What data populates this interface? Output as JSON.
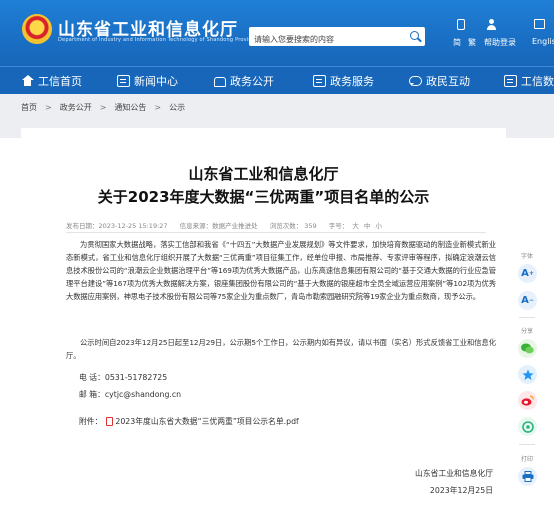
{
  "header": {
    "site_title": "山东省工业和信息化厅",
    "site_subtitle": "Department of Industry and Information Technology of Shandong Province",
    "search_placeholder": "请输入您要搜索的内容",
    "top_links": [
      "简",
      "繁",
      "帮助登录",
      "English"
    ]
  },
  "nav": {
    "items": [
      "工信首页",
      "新闻中心",
      "政务公开",
      "政务服务",
      "政民互动",
      "工信数"
    ]
  },
  "breadcrumb": [
    "首页",
    "政务公开",
    "通知公告",
    "公示"
  ],
  "article": {
    "title_line1": "山东省工业和信息化厅",
    "title_line2": "关于2023年度大数据“三优两重”项目名单的公示",
    "published": "发布日期：2023-12-25 15:19:27",
    "source": "信息来源：数据产业推进处",
    "views": "浏览次数：  359",
    "font_size_label": "字号：",
    "font_sizes": [
      "大",
      "中",
      "小"
    ],
    "paragraph1": "为贯彻国家大数据战略，落实工信部和我省《“十四五”大数据产业发展规划》等文件要求，加快培育数据驱动的制造业新模式新业态新模式，省工业和信息化厅组织开展了大数据“三优两重”项目征集工作，经单位申报、市局推荐、专家评审等程序，拟确定浪潮云信息技术股份公司的“浪潮云企业数据治理平台”等169项为优秀大数据产品，山东高速信息集团有限公司的“基于交通大数据的行业应急管理平台建设”等167项为优秀大数据解决方案，银座集团股份有限公司的“基于大数据的银座超市全员全域运营应用案例”等102项为优秀大数据应用案例，神思电子技术股份有限公司等75家企业为重点数厂，青岛市勒索园融研究院等19家企业为重点数商，现予公示。",
    "paragraph2": "公示时间自2023年12月25日起至12月29日，公示期5个工作日，公示期内如有异议，请以书面（实名）形式反馈省工业和信息化厅。",
    "phone": "电  话：0531-51782725",
    "email": "邮  箱：cytjc@shandong.cn",
    "attachment_label": "附件：",
    "attachment_link": "2023年度山东省大数据“三优两重”项目公示名单.pdf",
    "signature_org": "山东省工业和信息化厅",
    "signature_date": "2023年12月25日"
  },
  "toolbar": {
    "font_label": "字体",
    "font_up": "A",
    "font_down": "A",
    "share_label": "分享",
    "print_label": "打印"
  },
  "colors": {
    "header_blue": "#1a6fc4",
    "nav_blue": "#1766b9",
    "breadcrumb_bg": "#eceef1",
    "wechat_green": "#3cb034",
    "qzone_blue": "#2196f3",
    "weibo_red": "#e6162d"
  }
}
